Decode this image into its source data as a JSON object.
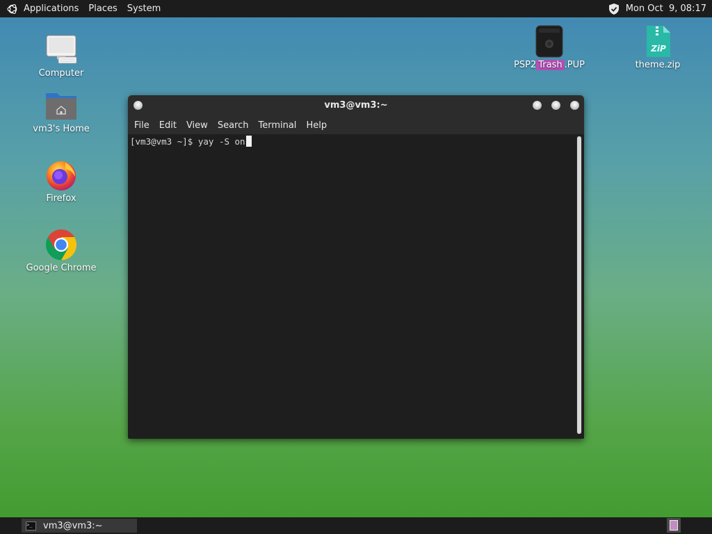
{
  "top_panel": {
    "menus": [
      "Applications",
      "Places",
      "System"
    ],
    "clock": "Mon Oct  9, 08:17"
  },
  "desktop": {
    "icons": [
      {
        "label": "Computer",
        "icon": "computer-icon"
      },
      {
        "label": "vm3's Home",
        "icon": "home-folder-icon"
      },
      {
        "label": "Firefox",
        "icon": "firefox-icon"
      },
      {
        "label": "Google Chrome",
        "icon": "chrome-icon"
      },
      {
        "label_left": "PSP2",
        "label_highlight": "Trash",
        "label_right": ".PUP",
        "icon": "trash-icon"
      },
      {
        "label": "theme.zip",
        "icon": "zip-file-icon"
      }
    ],
    "highlight_color": "#b44fb8"
  },
  "terminal": {
    "title": "vm3@vm3:~",
    "menu": [
      "File",
      "Edit",
      "View",
      "Search",
      "Terminal",
      "Help"
    ],
    "prompt": "[vm3@vm3 ~]$ ",
    "command": "yay -S on"
  },
  "bottom_panel": {
    "task_label": "vm3@vm3:~",
    "task_icon_text": ">_"
  }
}
